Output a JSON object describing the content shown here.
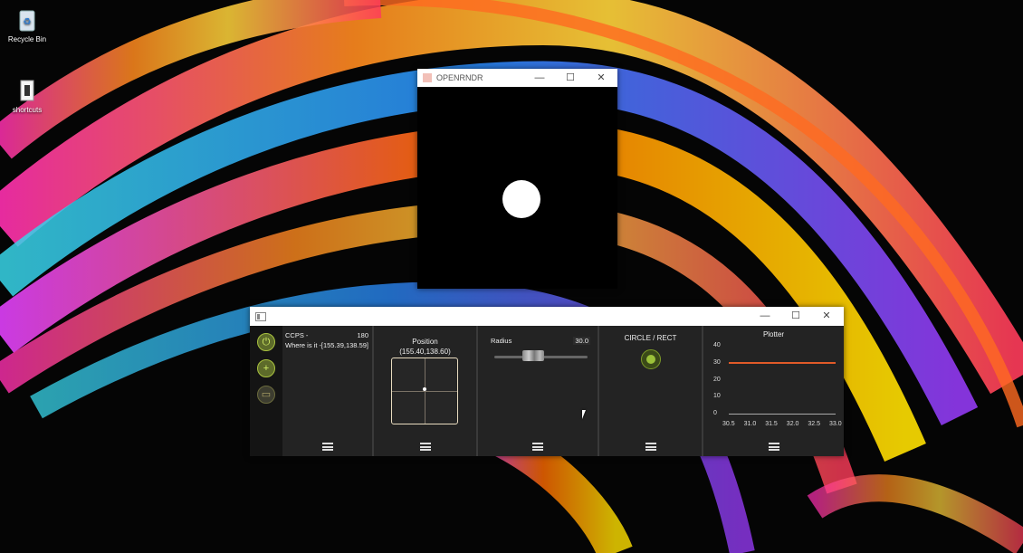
{
  "desktop": {
    "icons": [
      {
        "label": "Recycle Bin",
        "icon": "recycle-bin-icon"
      },
      {
        "label": "shortcuts",
        "icon": "folder-icon"
      }
    ]
  },
  "openrndr_window": {
    "title": "OPENRNDR",
    "controls": {
      "minimize": "—",
      "maximize": "☐",
      "close": "✕"
    }
  },
  "gui_window": {
    "controls": {
      "minimize": "—",
      "maximize": "☐",
      "close": "✕"
    },
    "sidebar": {
      "power": "⏻",
      "add": "+",
      "folder": "▭"
    },
    "stats": {
      "fps_label": "CCPS -",
      "fps_value": "180",
      "where_label": "Where is it -",
      "where_value": "[155.39,138.59]"
    },
    "position": {
      "title": "Position",
      "value": "(155.40,138.60)",
      "pad_x_fraction": 0.5,
      "pad_y_fraction": 0.5
    },
    "radius": {
      "label": "Radius",
      "value": "30.0"
    },
    "toggle": {
      "title": "CIRCLE / RECT",
      "state": "on"
    },
    "plotter": {
      "title": "Plotter"
    }
  },
  "chart_data": {
    "type": "line",
    "title": "Plotter",
    "x": [
      30.5,
      33.0
    ],
    "series": [
      {
        "values": [
          30,
          30
        ]
      }
    ],
    "xticks": [
      "30.5",
      "31.0",
      "31.5",
      "32.0",
      "32.5",
      "33.0"
    ],
    "yticks": [
      "0",
      "10",
      "20",
      "30",
      "40"
    ],
    "xlim": [
      30.5,
      33.0
    ],
    "ylim": [
      0,
      40
    ],
    "line_color": "#e05a28"
  },
  "colors": {
    "accent_green": "#9cc23a",
    "plot_line": "#e05a28"
  }
}
